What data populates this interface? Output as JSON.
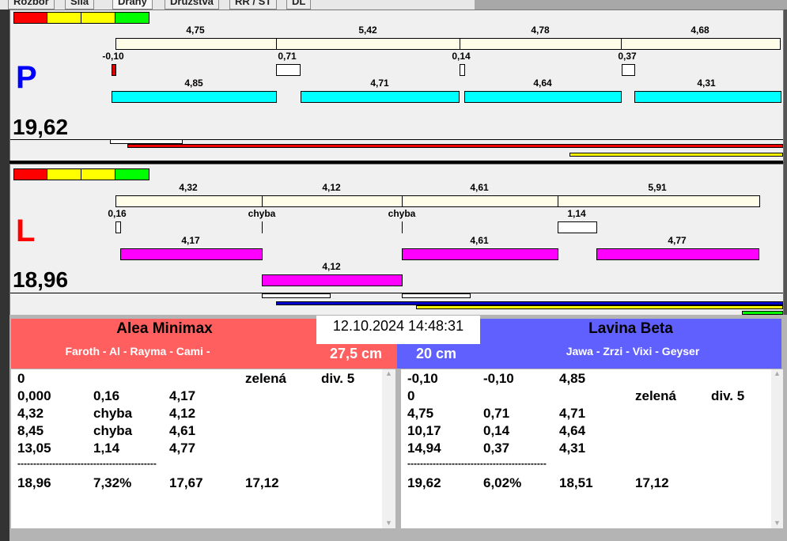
{
  "tabs": [
    "Rozbor",
    "Síla",
    "Dráhy",
    "Družstva",
    "RR / ST",
    "DL"
  ],
  "colors": {
    "red": "#ff0000",
    "yellow": "#ffff00",
    "green": "#00ff00",
    "cream": "#fffde8",
    "cyan": "#00ffff",
    "magenta": "#ff00ff",
    "team_a_header": "#ff5f5f",
    "team_b_header": "#6060ff",
    "blue_label": "#0000ff",
    "red_label": "#ff0000"
  },
  "lane_p": {
    "letter": "P",
    "total": "19,62",
    "top_values": [
      "4,75",
      "5,42",
      "4,78",
      "4,68"
    ],
    "mid_values": [
      "-0,10",
      "0,71",
      "0,14",
      "0,37"
    ],
    "bottom_values": [
      "4,85",
      "4,71",
      "4,64",
      "4,31"
    ]
  },
  "lane_l": {
    "letter": "L",
    "total": "18,96",
    "top_values": [
      "4,32",
      "4,12",
      "4,61",
      "5,91"
    ],
    "mid_values": [
      "0,16",
      "chyba",
      "chyba",
      "1,14"
    ],
    "bottom_values": [
      "4,17",
      "4,61",
      "4,77"
    ],
    "extra_value": "4,12"
  },
  "datetime": "12.10.2024 14:48:31",
  "team_a": {
    "name": "Alea Minimax",
    "players": "Faroth - Al - Rayma - Cami -",
    "distance": "27,5 cm",
    "rows": [
      [
        "0",
        "",
        "",
        "zelená",
        "div. 5"
      ],
      [
        "0,000",
        "0,16",
        "4,17",
        "",
        ""
      ],
      [
        "4,32",
        "chyba",
        "4,12",
        "",
        ""
      ],
      [
        "8,45",
        "chyba",
        "4,61",
        "",
        ""
      ],
      [
        "13,05",
        "1,14",
        "4,77",
        "",
        ""
      ]
    ],
    "separator": "--------------------------------------------",
    "summary": [
      "18,96",
      "7,32%",
      "17,67",
      "17,12"
    ]
  },
  "team_b": {
    "name": "Lavina Beta",
    "players": "Jawa - Zrzi - Vixi - Geyser",
    "distance": "20 cm",
    "rows": [
      [
        "-0,10",
        "-0,10",
        "4,85",
        "",
        ""
      ],
      [
        "0",
        "",
        "",
        "zelená",
        "div. 5"
      ],
      [
        "4,75",
        "0,71",
        "4,71",
        "",
        ""
      ],
      [
        "10,17",
        "0,14",
        "4,64",
        "",
        ""
      ],
      [
        "14,94",
        "0,37",
        "4,31",
        "",
        ""
      ]
    ],
    "separator": "--------------------------------------------",
    "summary": [
      "19,62",
      "6,02%",
      "18,51",
      "17,12"
    ]
  }
}
